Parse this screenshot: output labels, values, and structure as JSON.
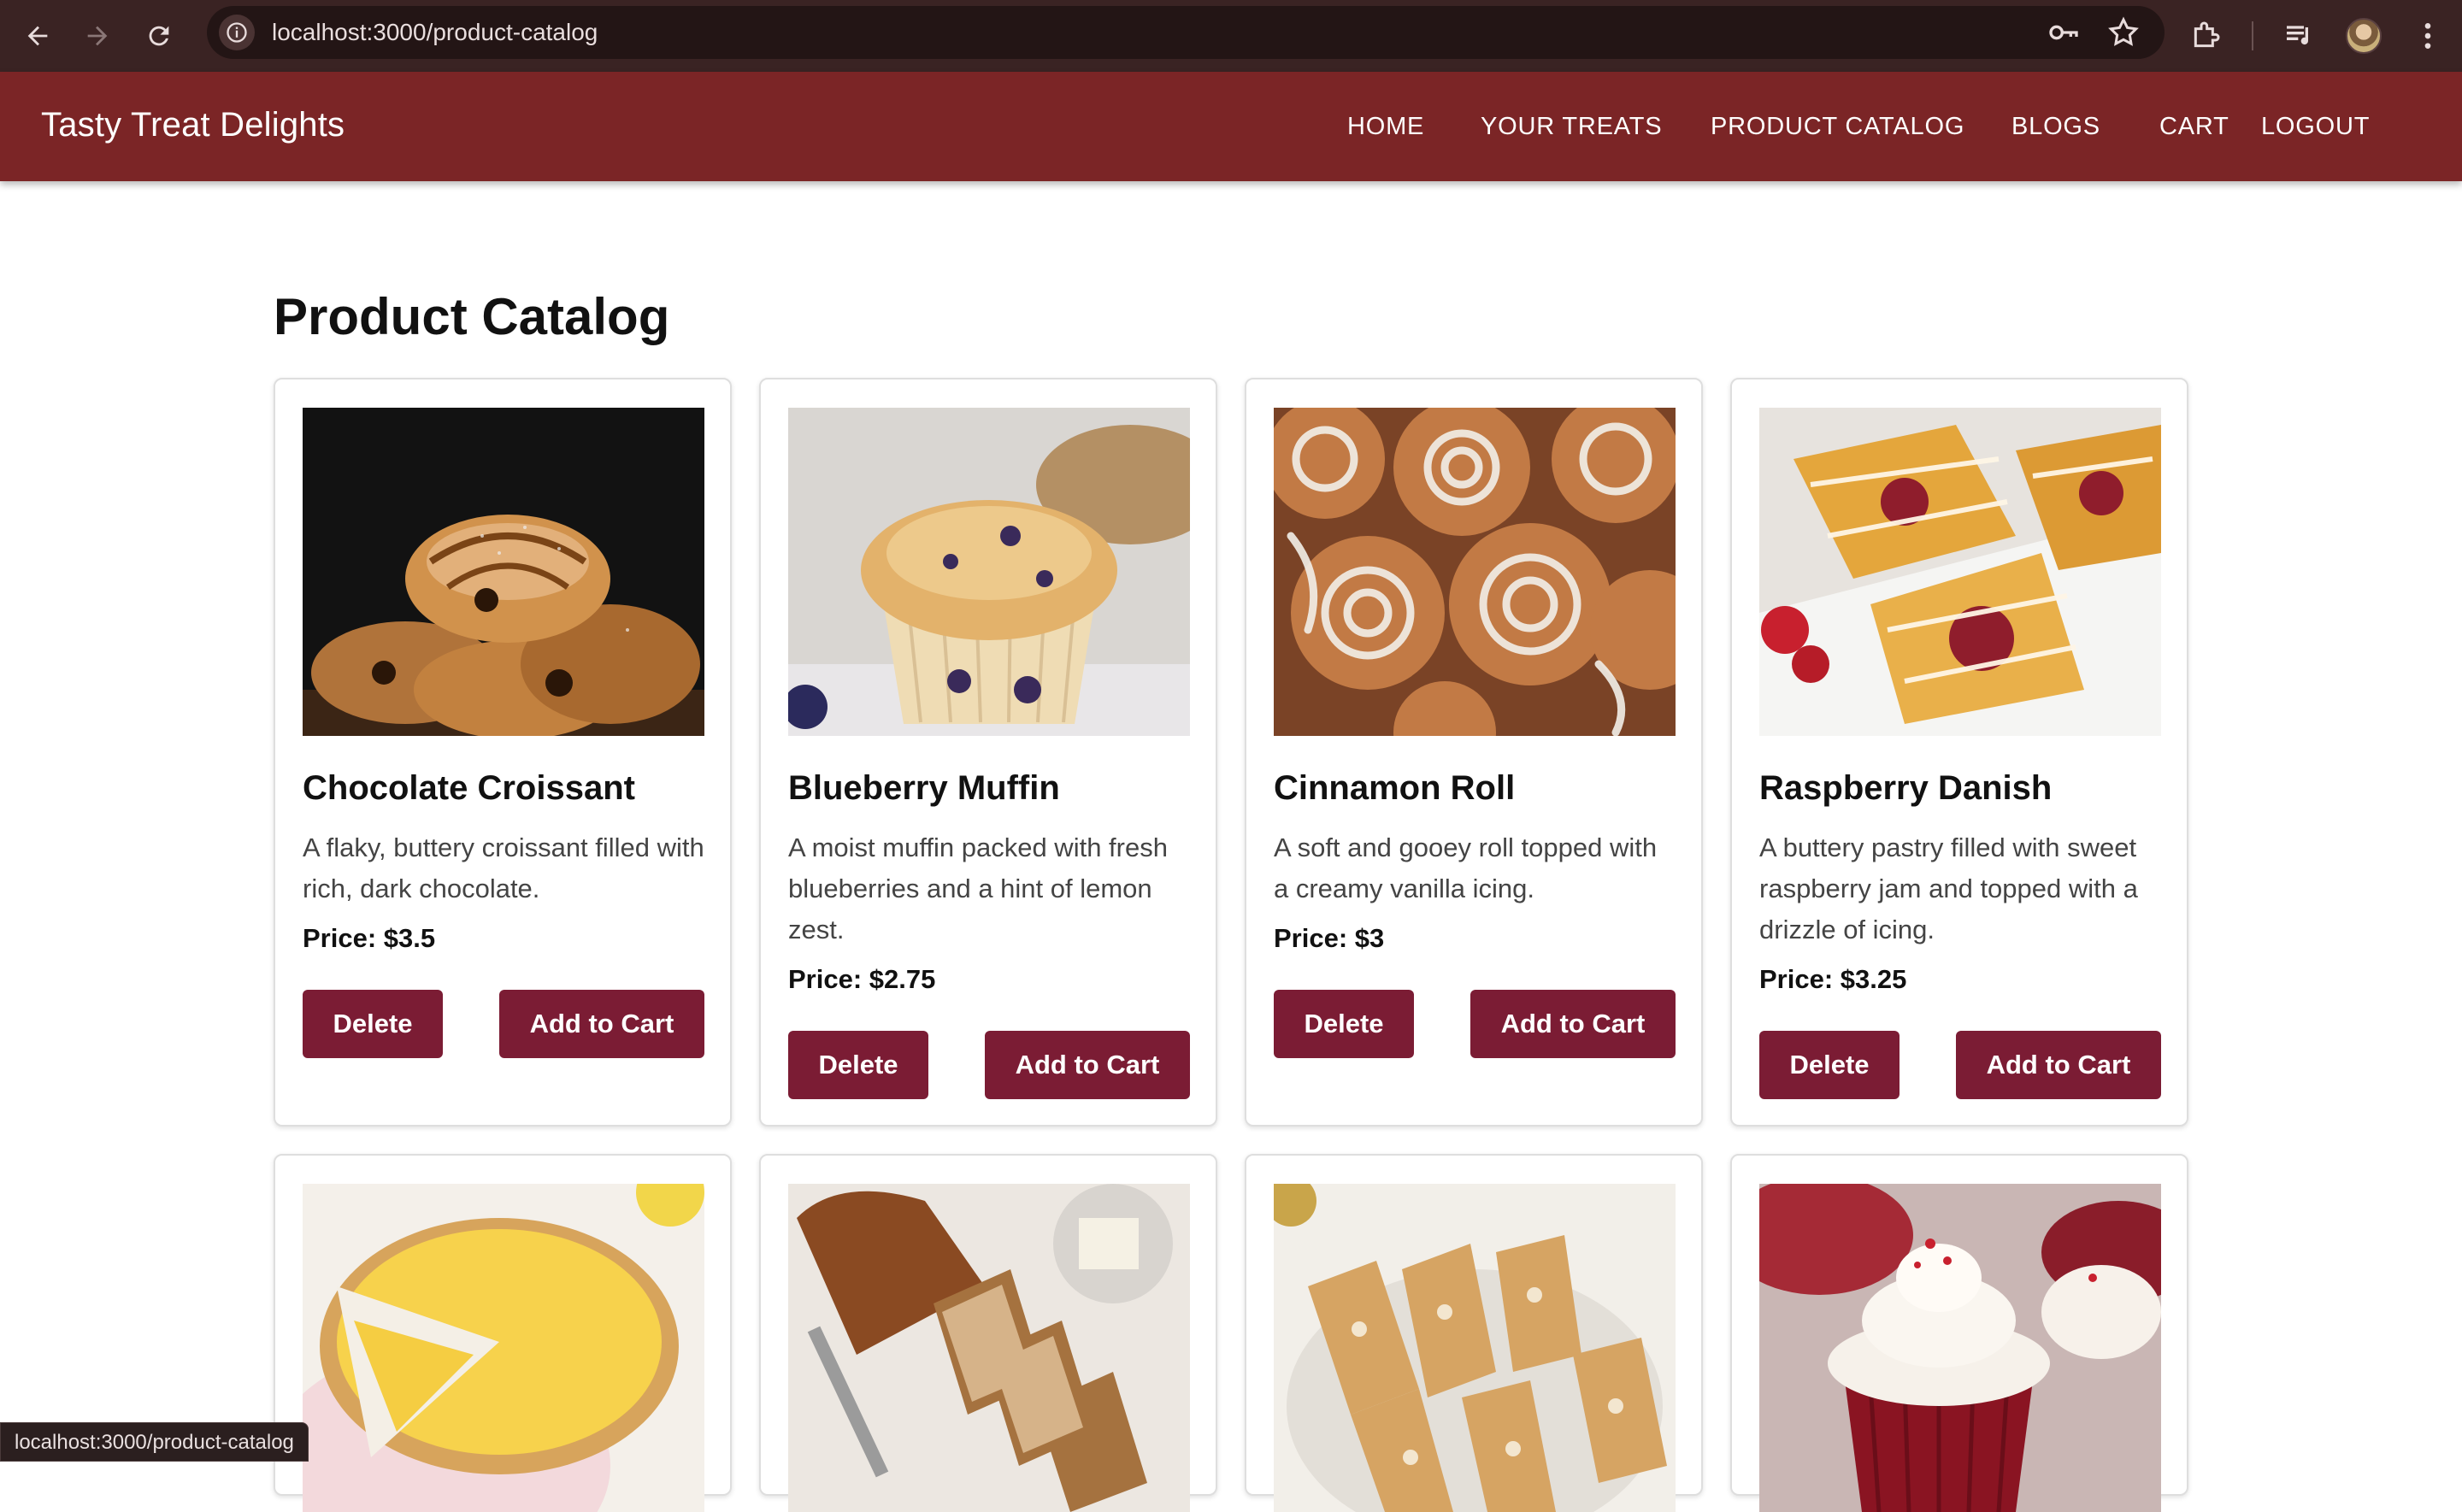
{
  "browser": {
    "url": "localhost:3000/product-catalog",
    "status_url": "localhost:3000/product-catalog"
  },
  "header": {
    "brand": "Tasty Treat Delights",
    "nav": [
      "HOME",
      "YOUR TREATS",
      "PRODUCT CATALOG",
      "BLOGS",
      "CART",
      "LOGOUT"
    ],
    "color": "#7b2526"
  },
  "page": {
    "title": "Product Catalog"
  },
  "buttons": {
    "delete": "Delete",
    "add_to_cart": "Add to Cart",
    "color": "#7b1c34"
  },
  "products": [
    {
      "name": "Chocolate Croissant",
      "description": "A flaky, buttery croissant filled with rich, dark chocolate.",
      "price": "Price: $3.5",
      "image": "croissant-photo"
    },
    {
      "name": "Blueberry Muffin",
      "description": "A moist muffin packed with fresh blueberries and a hint of lemon zest.",
      "price": "Price: $2.75",
      "image": "muffin-photo"
    },
    {
      "name": "Cinnamon Roll",
      "description": "A soft and gooey roll topped with a creamy vanilla icing.",
      "price": "Price: $3",
      "image": "cinnamon-roll-photo"
    },
    {
      "name": "Raspberry Danish",
      "description": "A buttery pastry filled with sweet raspberry jam and topped with a drizzle of icing.",
      "price": "Price: $3.25",
      "image": "danish-photo"
    },
    {
      "image": "lemon-tart-photo"
    },
    {
      "image": "banana-bread-photo"
    },
    {
      "image": "biscotti-photo"
    },
    {
      "image": "red-velvet-cupcake-photo"
    }
  ]
}
